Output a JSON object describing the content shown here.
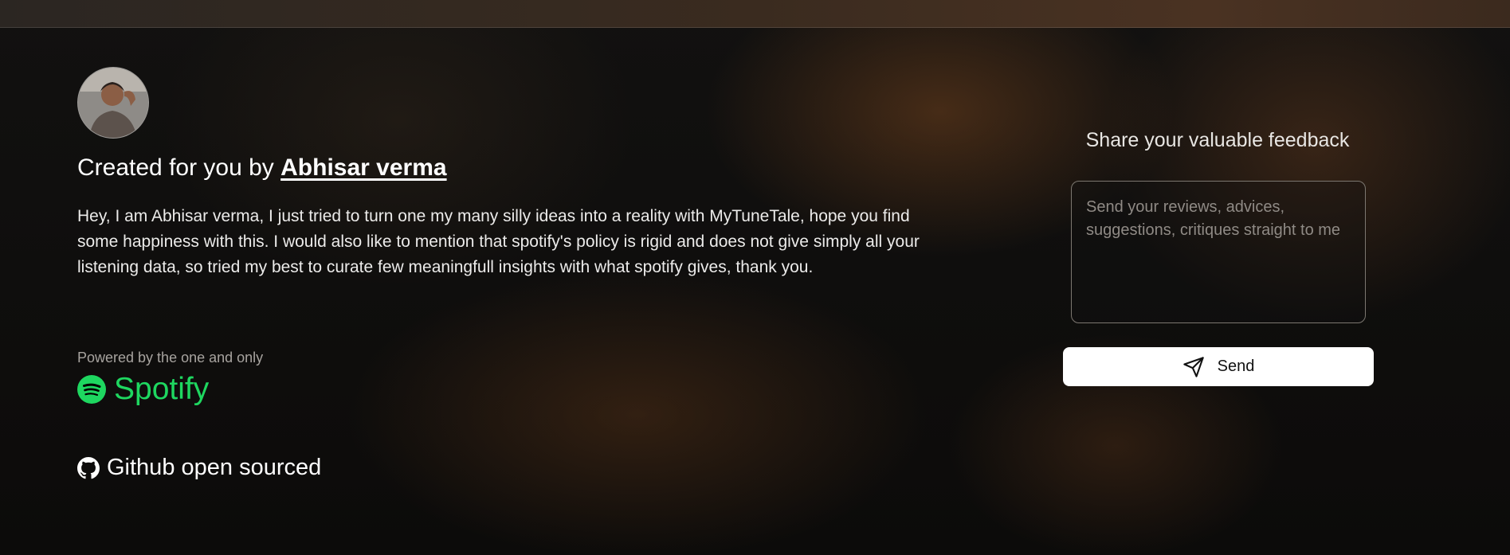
{
  "creator": {
    "heading_prefix": "Created for you by",
    "name": "Abhisar verma",
    "bio": "Hey, I am Abhisar verma, I just tried to turn one my many silly ideas into a reality with MyTuneTale, hope you find some happiness with this. I would also like to mention that spotify's policy is rigid and does not give simply all your listening data, so tried my best to curate few meaningfull insights with what spotify gives, thank you."
  },
  "powered": {
    "label": "Powered by the one and only",
    "brand": "Spotify",
    "brand_color": "#1ed760"
  },
  "github": {
    "label": "Github open sourced"
  },
  "feedback": {
    "title": "Share your valuable feedback",
    "value": "",
    "placeholder": "Send your reviews, advices, suggestions, critiques straight to me",
    "send_label": "Send"
  },
  "icons": {
    "avatar": "avatar",
    "spotify": "spotify-icon",
    "github": "github-icon",
    "send": "send-icon"
  }
}
